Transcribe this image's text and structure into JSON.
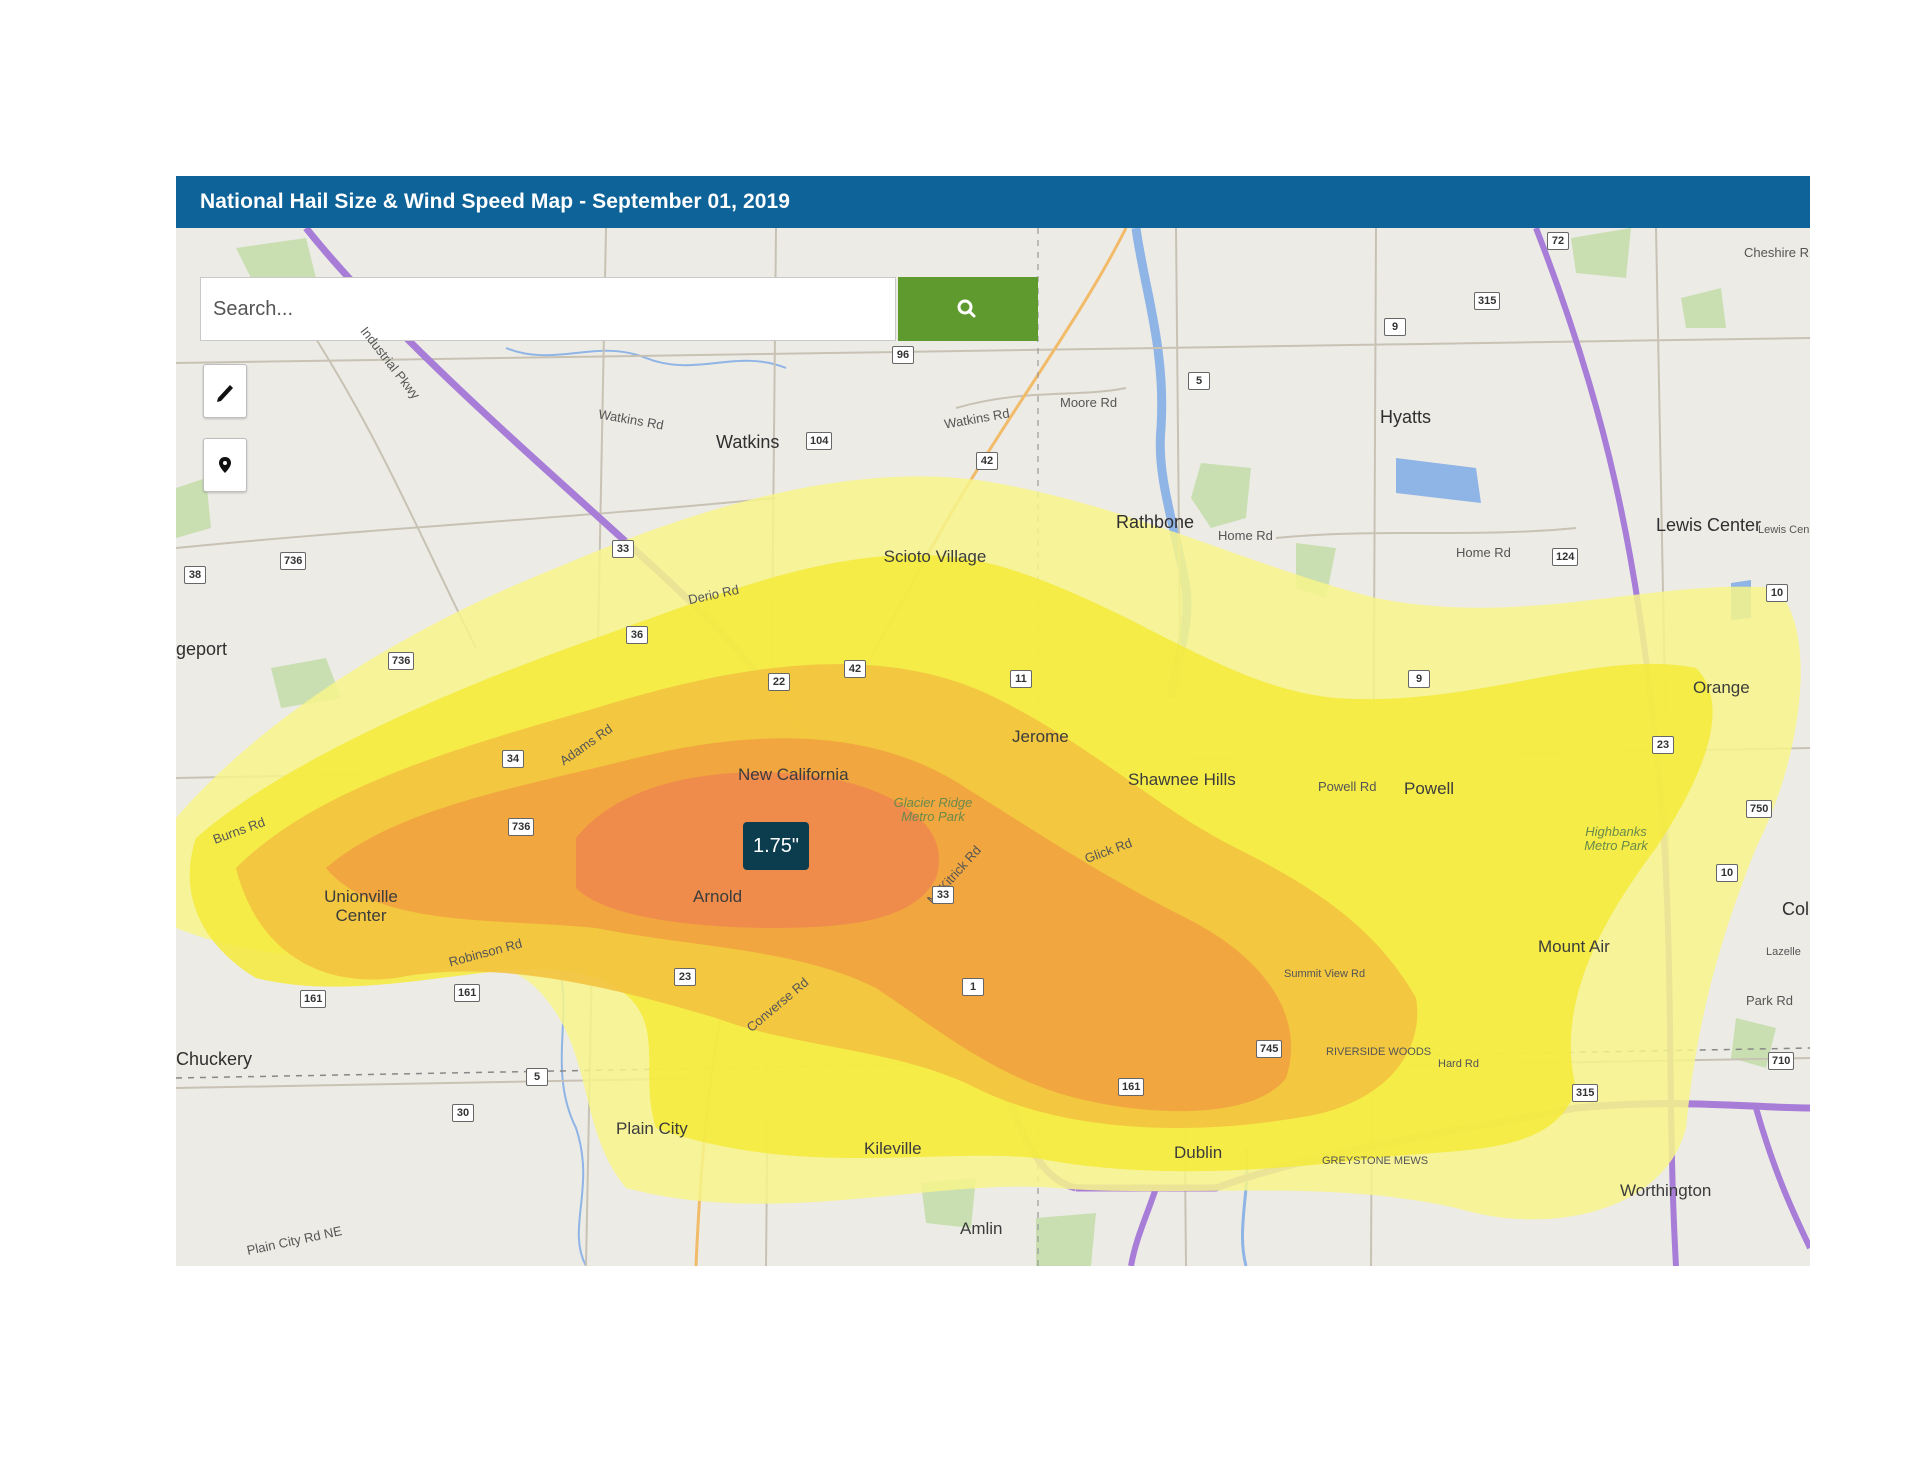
{
  "header": {
    "title": "National Hail Size & Wind Speed Map - September 01, 2019"
  },
  "search": {
    "placeholder": "Search...",
    "value": ""
  },
  "tools": [
    {
      "name": "draw-tool",
      "icon": "pencil-icon"
    },
    {
      "name": "marker-tool",
      "icon": "map-pin-icon"
    }
  ],
  "hail": {
    "label": "1.75\""
  },
  "legend_colors": {
    "light_yellow": "#f7f48a",
    "yellow": "#f5ea3a",
    "light_orange": "#f2c13e",
    "orange": "#f0a040",
    "dark_orange": "#ee8a4e"
  },
  "places": {
    "watkins": "Watkins",
    "hyatts": "Hyatts",
    "rathbone": "Rathbone",
    "lewis_center": "Lewis Center",
    "scioto_village": "Scioto Village",
    "bridgeport": "geport",
    "orange": "Orange",
    "jerome": "Jerome",
    "new_california": "New California",
    "shawnee_hills": "Shawnee Hills",
    "powell": "Powell",
    "unionville_center": "Unionville Center",
    "arnold": "Arnold",
    "mount_air": "Mount Air",
    "columbus": "Colu",
    "chuckery": "Chuckery",
    "plain_city": "Plain City",
    "kileville": "Kileville",
    "dublin": "Dublin",
    "worthington": "Worthington",
    "amlin": "Amlin"
  },
  "parks": {
    "glacier_ridge": "Glacier Ridge Metro Park",
    "highbanks": "Highbanks Metro Park",
    "riverside_woods": "RIVERSIDE WOODS",
    "greystone_mews": "GREYSTONE MEWS"
  },
  "roads": {
    "industrial_pkwy": "Industrial Pkwy",
    "watkins_rd": "Watkins Rd",
    "moore_rd": "Moore Rd",
    "home_rd": "Home Rd",
    "deric_rd": "Derio Rd",
    "adams_rd": "Adams Rd",
    "burns_rd": "Burns Rd",
    "robinson_rd": "Robinson Rd",
    "converse_rd": "Converse Rd",
    "glick_rd": "Glick Rd",
    "powell_rd": "Powell Rd",
    "summit_view_rd": "Summit View Rd",
    "hard_rd": "Hard Rd",
    "mckitrick_rd": "McKitrick Rd",
    "park_rd": "Park Rd",
    "cheshire_rd": "Cheshire R",
    "plain_city_rd": "Plain City Rd NE",
    "lazelle": "Lazelle",
    "lewis_cen": "Lewis Cen"
  },
  "shields": [
    "72",
    "315",
    "9",
    "5",
    "96",
    "104",
    "42",
    "33",
    "736",
    "38",
    "36",
    "22",
    "42",
    "11",
    "124",
    "10",
    "736",
    "34",
    "736",
    "33",
    "1",
    "23",
    "161",
    "161",
    "5",
    "30",
    "161",
    "745",
    "710",
    "315",
    "750",
    "10",
    "23",
    "9"
  ]
}
